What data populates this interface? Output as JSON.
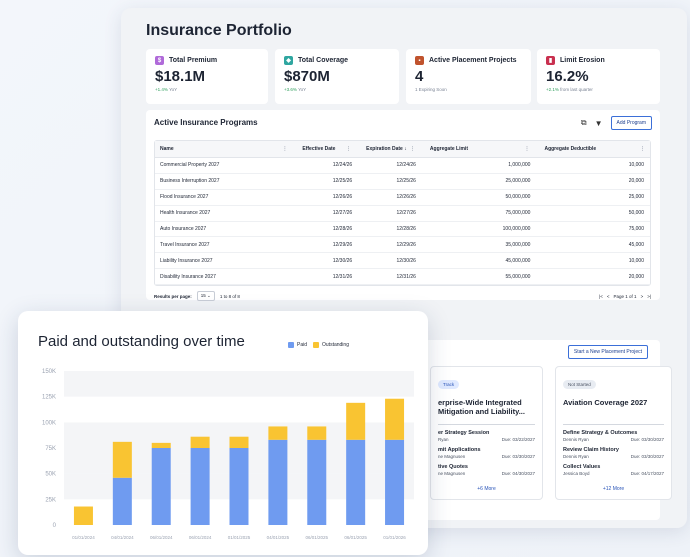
{
  "page_title": "Insurance Portfolio",
  "kpis": [
    {
      "icon": "dollar-icon",
      "label": "Total Premium",
      "value": "$18.1M",
      "delta": "+1.4%",
      "delta_suffix": "YoY",
      "color": "#b06ad9"
    },
    {
      "icon": "shield-icon",
      "label": "Total Coverage",
      "value": "$870M",
      "delta": "+3.6%",
      "delta_suffix": "YoY",
      "color": "#2fa6a0"
    },
    {
      "icon": "briefcase-icon",
      "label": "Active Placement Projects",
      "value": "4",
      "delta": "",
      "delta_suffix": "1 Expiring Soon",
      "color": "#c0532d"
    },
    {
      "icon": "bar-chart-icon",
      "label": "Limit Erosion",
      "value": "16.2%",
      "delta": "+2.1%",
      "delta_suffix": "from last quarter",
      "color": "#c9304f"
    }
  ],
  "programs": {
    "title": "Active Insurance Programs",
    "add_label": "Add Program",
    "columns": {
      "name": "Name",
      "effective": "Effective Date",
      "expiration": "Expiration Date",
      "agg_limit": "Aggregate Limit",
      "agg_ded": "Aggregate Deductible"
    },
    "rows": [
      {
        "name": "Commercial Property 2027",
        "effective": "12/24/26",
        "expiration": "12/24/26",
        "agg_limit": "1,000,000",
        "agg_ded": "10,000"
      },
      {
        "name": "Business Interruption 2027",
        "effective": "12/25/26",
        "expiration": "12/25/26",
        "agg_limit": "25,000,000",
        "agg_ded": "20,000"
      },
      {
        "name": "Flood Insurance 2027",
        "effective": "12/26/26",
        "expiration": "12/26/26",
        "agg_limit": "50,000,000",
        "agg_ded": "25,000"
      },
      {
        "name": "Health Insurance 2027",
        "effective": "12/27/26",
        "expiration": "12/27/26",
        "agg_limit": "75,000,000",
        "agg_ded": "50,000"
      },
      {
        "name": "Auto Insurance 2027",
        "effective": "12/28/26",
        "expiration": "12/28/26",
        "agg_limit": "100,000,000",
        "agg_ded": "75,000"
      },
      {
        "name": "Travel Insurance 2027",
        "effective": "12/29/26",
        "expiration": "12/29/26",
        "agg_limit": "35,000,000",
        "agg_ded": "45,000"
      },
      {
        "name": "Liability Insurance 2027",
        "effective": "12/30/26",
        "expiration": "12/30/26",
        "agg_limit": "45,000,000",
        "agg_ded": "10,000"
      },
      {
        "name": "Disability Insurance 2027",
        "effective": "12/31/26",
        "expiration": "12/31/26",
        "agg_limit": "55,000,000",
        "agg_ded": "20,000"
      }
    ],
    "pager": {
      "results_label": "Results per page:",
      "page_size": "15",
      "range": "1 to 8 of 8",
      "page_text": "Page 1 of 1"
    }
  },
  "placement": {
    "start_label": "Start a New Placement Project",
    "projects": [
      {
        "badge": "Track",
        "title_line1": "erprise-Wide Integrated",
        "title_line2": "Mitigation and Liability...",
        "tasks": [
          {
            "name": "er Strategy Session",
            "owner": "Ryan",
            "due": "Due: 03/22/2027"
          },
          {
            "name": "mit Applications",
            "owner": "ne Magnusen",
            "due": "Due: 03/30/2027"
          },
          {
            "name": "tive Quotes",
            "owner": "ne Magnusen",
            "due": "Due: 04/30/2027"
          }
        ],
        "more": "+6 More"
      },
      {
        "badge": "Not Started",
        "title_line1": "Aviation Coverage 2027",
        "title_line2": "",
        "tasks": [
          {
            "name": "Define Strategy & Outcomes",
            "owner": "Dennis Ryan",
            "due": "Due: 03/30/2027"
          },
          {
            "name": "Review Claim History",
            "owner": "Dennis Ryan",
            "due": "Due: 03/30/2027"
          },
          {
            "name": "Collect Values",
            "owner": "Jessica Boyd",
            "due": "Due: 04/17/2027"
          }
        ],
        "more": "+12 More"
      }
    ]
  },
  "chart_data": {
    "type": "bar",
    "stacked": true,
    "title": "Paid and outstanding over time",
    "categories": [
      "01/01/2024",
      "04/01/2024",
      "06/01/2024",
      "06/01/2024",
      "01/01/2025",
      "04/01/2025",
      "06/01/2025",
      "06/01/2025",
      "01/01/2026"
    ],
    "series": [
      {
        "name": "Paid",
        "color": "#6f9bf0",
        "values": [
          0,
          46000,
          75000,
          75000,
          75000,
          83000,
          83000,
          83000,
          83000
        ]
      },
      {
        "name": "Outstanding",
        "color": "#f9c432",
        "values": [
          18000,
          35000,
          5000,
          11000,
          11000,
          13000,
          13000,
          36000,
          40000
        ]
      }
    ],
    "y_ticks": [
      "0",
      "25K",
      "50K",
      "75K",
      "100K",
      "125K",
      "150K"
    ],
    "ylim": [
      0,
      150000
    ],
    "grid": "alternating-bands",
    "legend": "top-right"
  }
}
